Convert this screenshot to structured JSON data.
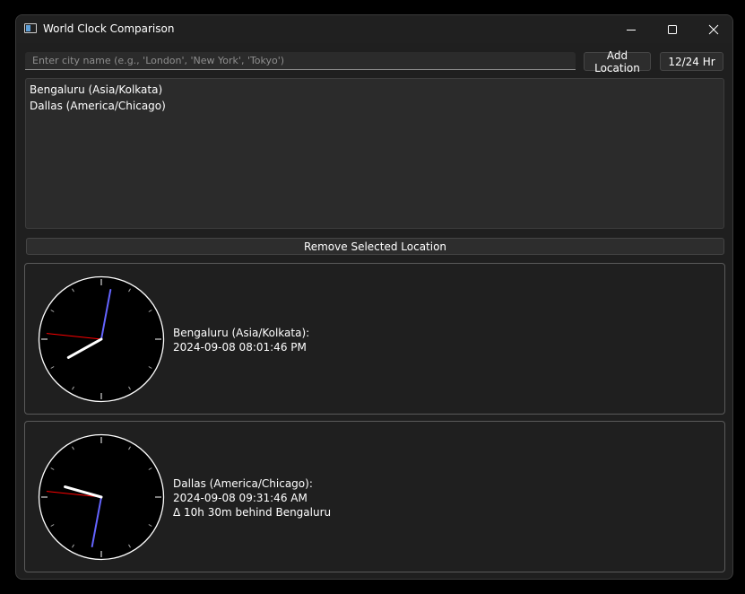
{
  "window": {
    "title": "World Clock Comparison"
  },
  "controls": {
    "city_placeholder": "Enter city name (e.g., 'London', 'New York', 'Tokyo')",
    "city_value": "",
    "add_label": "Add Location",
    "format_label": "12/24 Hr",
    "remove_label": "Remove Selected Location"
  },
  "locations": [
    "Bengaluru (Asia/Kolkata)",
    "Dallas (America/Chicago)"
  ],
  "clocks": [
    {
      "label": "Bengaluru (Asia/Kolkata):",
      "datetime": "2024-09-08 08:01:46 PM",
      "diff": "",
      "hour": 20,
      "minute": 1,
      "second": 46
    },
    {
      "label": "Dallas (America/Chicago):",
      "datetime": "2024-09-08 09:31:46 AM",
      "diff": "Δ 10h 30m behind Bengaluru",
      "hour": 9,
      "minute": 31,
      "second": 46
    }
  ],
  "colors": {
    "minute_hand": "#6464ff",
    "second_hand": "#ff0000",
    "hour_hand": "#ffffff",
    "clock_face": "#000000"
  }
}
